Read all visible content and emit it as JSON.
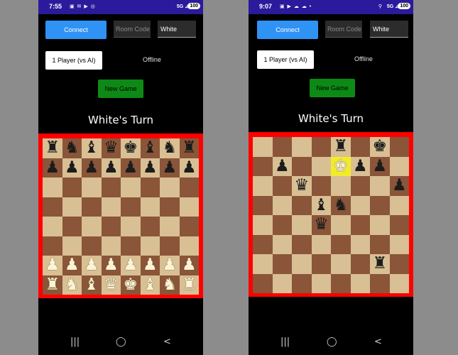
{
  "screens": [
    {
      "status_bar": {
        "time": "7:55",
        "left_icons": "▣ ✉ ▶ ◎",
        "right_icons": "",
        "network": "5G ⊿",
        "battery": "100"
      },
      "connect_label": "Connect",
      "room_code_placeholder": "Room Code",
      "color_value": "White",
      "mode_label": "1 Player (vs AI)",
      "connection_status": "Offline",
      "new_game_label": "New Game",
      "turn_text": "White's Turn",
      "board": [
        "rnbqkbnr",
        "pppppppp",
        "........",
        "........",
        "........",
        "........",
        "PPPPPPPP",
        "RNBQKBNR"
      ],
      "highlight": []
    },
    {
      "status_bar": {
        "time": "9:07",
        "left_icons": "▣ ▶ ☁ ☁ •",
        "right_icons": "⚲",
        "network": "5G ⊿",
        "battery": "100"
      },
      "connect_label": "Connect",
      "room_code_placeholder": "Room Code",
      "color_value": "White",
      "mode_label": "1 Player (vs AI)",
      "connection_status": "Offline",
      "new_game_label": "New Game",
      "turn_text": "White's Turn",
      "board": [
        "....r.k.",
        ".p..Kpp.",
        "..q....p",
        "...bn...",
        "...q....",
        "........",
        "......r.",
        "........"
      ],
      "highlight": [
        [
          1,
          4
        ]
      ]
    }
  ],
  "nav_icons": {
    "recents": "recents-icon",
    "home": "home-icon",
    "back": "back-icon"
  },
  "colors": {
    "status_bar": "#2b1a9c",
    "connect_button": "#2f92f5",
    "new_game_button": "#0d8a15",
    "board_border": "#ff0000",
    "light_square": "#d9bf94",
    "dark_square": "#8a5538",
    "highlight": "#f2ec28"
  }
}
